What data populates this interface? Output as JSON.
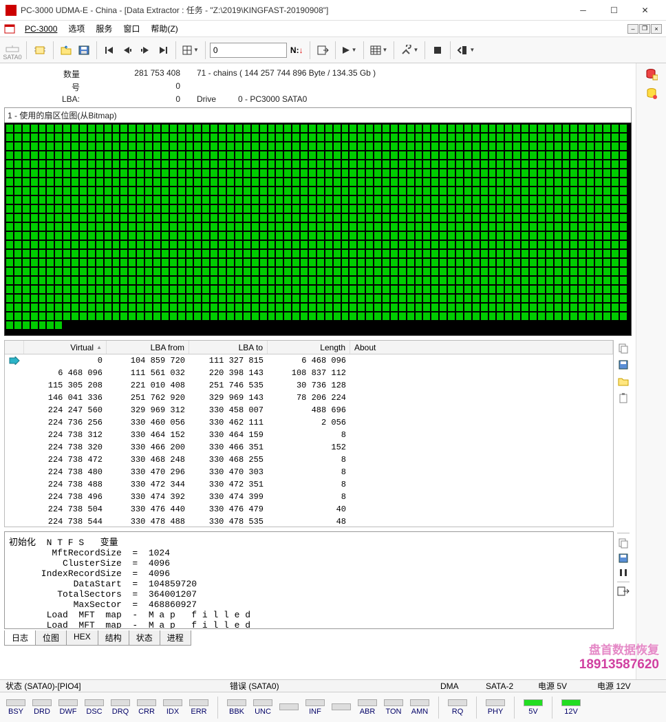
{
  "window": {
    "title": "PC-3000 UDMA-E - China - [Data Extractor : 任务 - \"Z:\\2019\\KINGFAST-20190908\"]"
  },
  "menu": {
    "app": "PC-3000",
    "items": [
      "选项",
      "服务",
      "窗口",
      "帮助(Z)"
    ]
  },
  "toolbar": {
    "sata": "SATA0",
    "address": "0",
    "nav_marker": "N:"
  },
  "info": {
    "qty_label": "数量",
    "qty_value": "281 753 408",
    "qty_extra": "71 - chains  ( 144 257 744 896 Byte /  134.35 Gb )",
    "num_label": "号",
    "num_value": "0",
    "lba_label": "LBA:",
    "lba_value": "0",
    "drive_label": "Drive",
    "drive_value": "0 - PC3000 SATA0"
  },
  "bitmap": {
    "title": "1 - 使用的扇区位图(从Bitmap)"
  },
  "table": {
    "headers": {
      "virtual": "Virtual",
      "lba_from": "LBA from",
      "lba_to": "LBA to",
      "length": "Length",
      "about": "About"
    },
    "rows": [
      {
        "virtual": "0",
        "from": "104 859 720",
        "to": "111 327 815",
        "len": "6 468 096"
      },
      {
        "virtual": "6 468 096",
        "from": "111 561 032",
        "to": "220 398 143",
        "len": "108 837 112"
      },
      {
        "virtual": "115 305 208",
        "from": "221 010 408",
        "to": "251 746 535",
        "len": "30 736 128"
      },
      {
        "virtual": "146 041 336",
        "from": "251 762 920",
        "to": "329 969 143",
        "len": "78 206 224"
      },
      {
        "virtual": "224 247 560",
        "from": "329 969 312",
        "to": "330 458 007",
        "len": "488 696"
      },
      {
        "virtual": "224 736 256",
        "from": "330 460 056",
        "to": "330 462 111",
        "len": "2 056"
      },
      {
        "virtual": "224 738 312",
        "from": "330 464 152",
        "to": "330 464 159",
        "len": "8"
      },
      {
        "virtual": "224 738 320",
        "from": "330 466 200",
        "to": "330 466 351",
        "len": "152"
      },
      {
        "virtual": "224 738 472",
        "from": "330 468 248",
        "to": "330 468 255",
        "len": "8"
      },
      {
        "virtual": "224 738 480",
        "from": "330 470 296",
        "to": "330 470 303",
        "len": "8"
      },
      {
        "virtual": "224 738 488",
        "from": "330 472 344",
        "to": "330 472 351",
        "len": "8"
      },
      {
        "virtual": "224 738 496",
        "from": "330 474 392",
        "to": "330 474 399",
        "len": "8"
      },
      {
        "virtual": "224 738 504",
        "from": "330 476 440",
        "to": "330 476 479",
        "len": "40"
      },
      {
        "virtual": "224 738 544",
        "from": "330 478 488",
        "to": "330 478 535",
        "len": "48"
      }
    ]
  },
  "log": {
    "text": "初始化  N T F S   变量\n        MftRecordSize  =  1024\n          ClusterSize  =  4096\n      IndexRecordSize  =  4096\n            DataStart  =  104859720\n         TotalSectors  =  364001207\n            MaxSector  =  468860927\n       Load  MFT  map  -  M a p   f i l l e d\n       Load  MFT  map  -  M a p   f i l l e d",
    "tabs": [
      "日志",
      "位图",
      "HEX",
      "结构",
      "状态",
      "进程"
    ]
  },
  "status": {
    "s1": "状态 (SATA0)-[PIO4]",
    "s2": "错误 (SATA0)",
    "dma": "DMA",
    "sata2": "SATA-2",
    "p5": "电源 5V",
    "p12": "电源 12V"
  },
  "leds": {
    "group1": [
      "BSY",
      "DRD",
      "DWF",
      "DSC",
      "DRQ",
      "CRR",
      "IDX",
      "ERR"
    ],
    "group2": [
      "BBK",
      "UNC",
      "",
      "INF",
      "",
      "ABR",
      "TON",
      "AMN"
    ],
    "dma": "RQ",
    "sata2": "PHY",
    "p5": "5V",
    "p12": "12V"
  },
  "watermark": {
    "l1": "盘首数据恢复",
    "l2": "18913587620"
  }
}
